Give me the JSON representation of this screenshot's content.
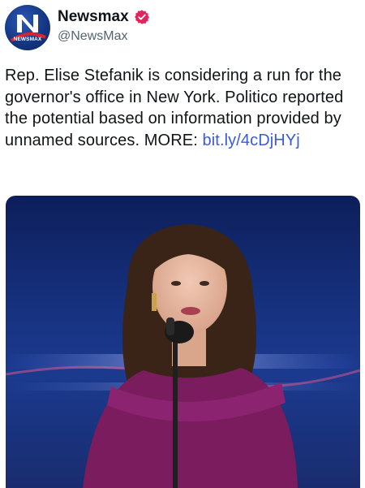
{
  "account": {
    "display_name": "Newsmax",
    "handle": "@NewsMax",
    "avatar_text": "NEWSMAX",
    "avatar_letter": "N",
    "verified_color": "#e0245e"
  },
  "tweet": {
    "text": "Rep. Elise Stefanik is considering a run for the governor's office in New York. Politico reported the potential based on information provided by unnamed sources. MORE: ",
    "link_text": "bit.ly/4cDjHYj",
    "link_color": "#3b5bd6"
  },
  "media": {
    "icon": "photo",
    "colors": {
      "background": "#16307c",
      "dress": "#7a1c5e"
    }
  }
}
